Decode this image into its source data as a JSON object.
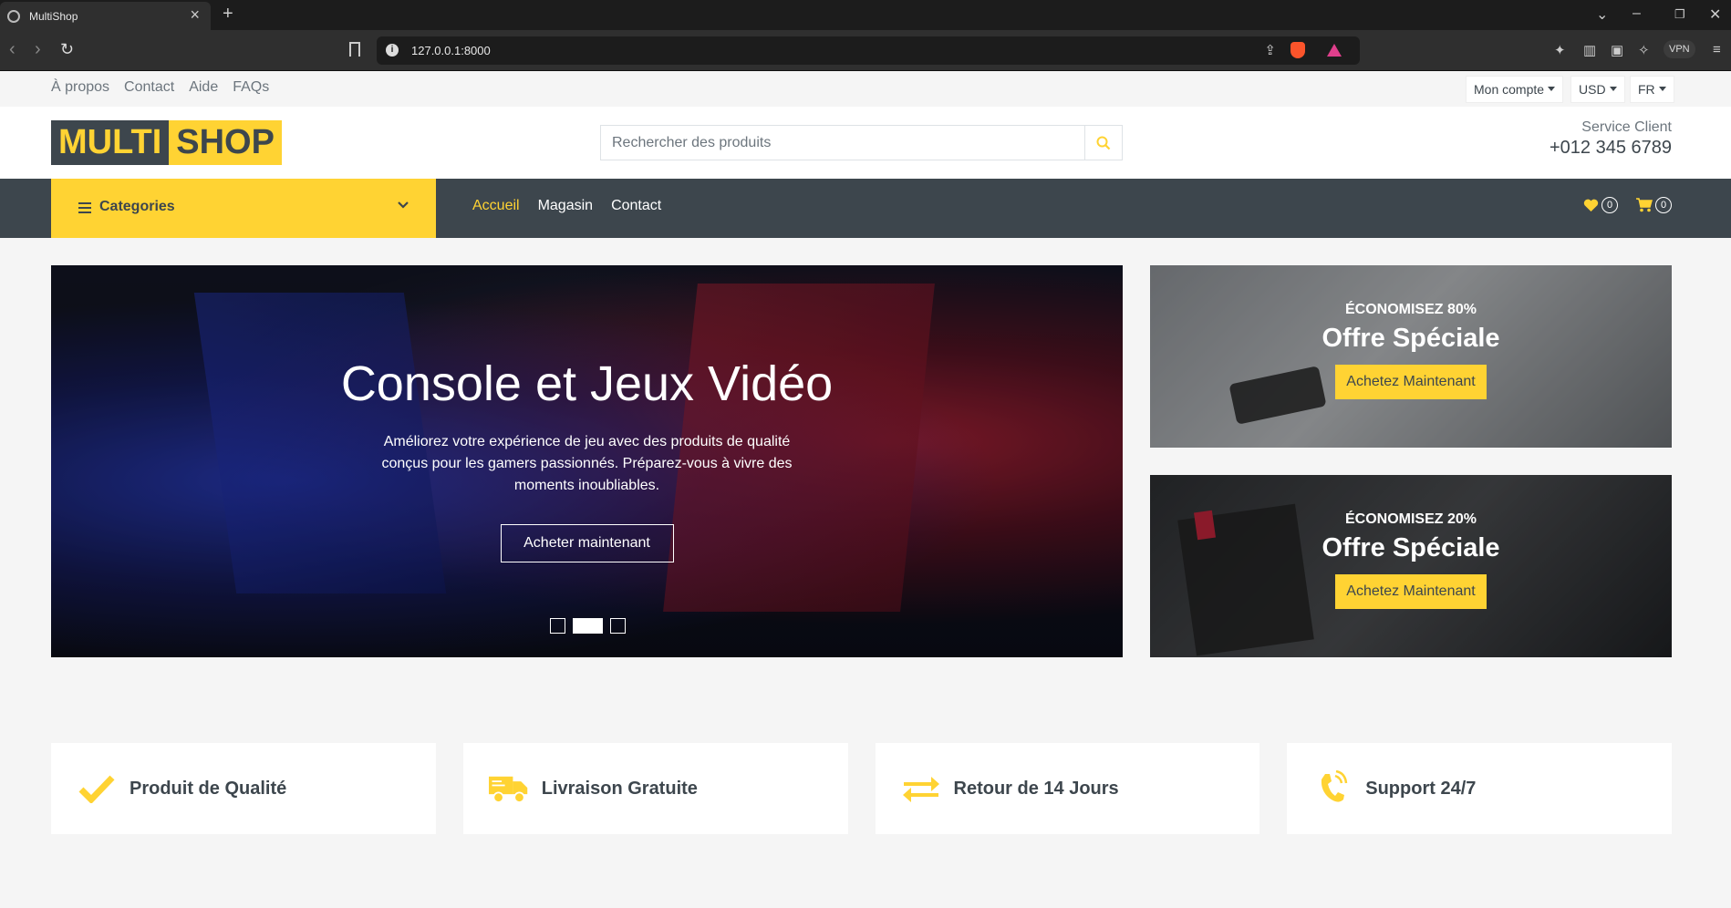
{
  "browser": {
    "tab_title": "MultiShop",
    "url": "127.0.0.1:8000",
    "vpn_label": "VPN"
  },
  "topbar": {
    "links": [
      "À propos",
      "Contact",
      "Aide",
      "FAQs"
    ],
    "account_label": "Mon compte",
    "currency_label": "USD",
    "language_label": "FR"
  },
  "brand": {
    "logo_part1": "MULTI",
    "logo_part2": "SHOP",
    "search_placeholder": "Rechercher des produits",
    "service_label": "Service Client",
    "phone": "+012 345 6789"
  },
  "nav": {
    "categories_label": "Categories",
    "menu": [
      "Accueil",
      "Magasin",
      "Contact"
    ],
    "active_index": 0,
    "wishlist_count": "0",
    "cart_count": "0"
  },
  "hero": {
    "title": "Console et Jeux Vidéo",
    "description": "Améliorez votre expérience de jeu avec des produits de qualité conçus pour les gamers passionnés. Préparez-vous à vivre des moments inoubliables.",
    "button_label": "Acheter maintenant",
    "slide_count": 3,
    "active_slide": 2
  },
  "offers": [
    {
      "save": "ÉCONOMISEZ 80%",
      "title": "Offre Spéciale",
      "button": "Achetez Maintenant"
    },
    {
      "save": "ÉCONOMISEZ 20%",
      "title": "Offre Spéciale",
      "button": "Achetez Maintenant"
    }
  ],
  "features": [
    {
      "label": "Produit de Qualité",
      "icon": "check-icon"
    },
    {
      "label": "Livraison Gratuite",
      "icon": "shipping-truck-icon"
    },
    {
      "label": "Retour de 14 Jours",
      "icon": "exchange-arrows-icon"
    },
    {
      "label": "Support 24/7",
      "icon": "phone-volume-icon"
    }
  ],
  "colors": {
    "primary": "#ffd333",
    "dark": "#3d464d",
    "muted": "#6c757d"
  }
}
